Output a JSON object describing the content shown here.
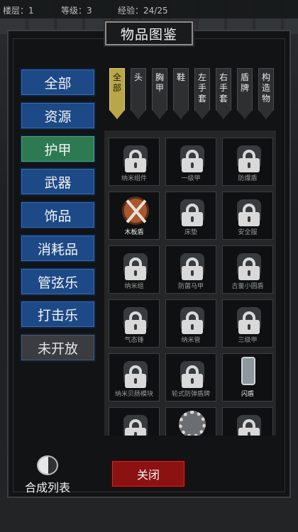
{
  "status": {
    "floor": "楼层：1",
    "level": "等级：3",
    "exp": "经验：24/25"
  },
  "title": "物品图鉴",
  "categories": [
    {
      "label": "全部",
      "state": "normal"
    },
    {
      "label": "资源",
      "state": "normal"
    },
    {
      "label": "护甲",
      "state": "active"
    },
    {
      "label": "武器",
      "state": "normal"
    },
    {
      "label": "饰品",
      "state": "normal"
    },
    {
      "label": "消耗品",
      "state": "normal"
    },
    {
      "label": "管弦乐",
      "state": "normal"
    },
    {
      "label": "打击乐",
      "state": "normal"
    },
    {
      "label": "未开放",
      "state": "disabled"
    }
  ],
  "tabs": [
    "全部",
    "头",
    "胸甲",
    "鞋",
    "左手套",
    "右手套",
    "盾牌",
    "构造物"
  ],
  "active_tab": 0,
  "items": [
    {
      "name": "纳米组件",
      "locked": true
    },
    {
      "name": "一级甲",
      "locked": true
    },
    {
      "name": "防爆盾",
      "locked": true
    },
    {
      "name": "木板盾",
      "locked": false,
      "icon": "wooden-shield-icon"
    },
    {
      "name": "床垫",
      "locked": true
    },
    {
      "name": "安全服",
      "locked": true
    },
    {
      "name": "纳米组",
      "locked": true
    },
    {
      "name": "防菌马甲",
      "locked": true
    },
    {
      "name": "古董小圆盾",
      "locked": true
    },
    {
      "name": "气态锤",
      "locked": true
    },
    {
      "name": "纳米管",
      "locked": true
    },
    {
      "name": "三级甲",
      "locked": true
    },
    {
      "name": "纳米贝肠模块",
      "locked": true
    },
    {
      "name": "轮式防弹盾牌",
      "locked": true
    },
    {
      "name": "闪盾",
      "locked": false,
      "icon": "riot-shield-icon"
    },
    {
      "name": "",
      "locked": true
    },
    {
      "name": "",
      "locked": false,
      "icon": "gear-icon"
    },
    {
      "name": "",
      "locked": true
    }
  ],
  "craft_label": "合成列表",
  "close_label": "关闭",
  "colors": {
    "category_blue": "#1d4a86",
    "category_active": "#2d7a52",
    "close_red": "#8c1212",
    "tab_active": "#b9a64a"
  }
}
